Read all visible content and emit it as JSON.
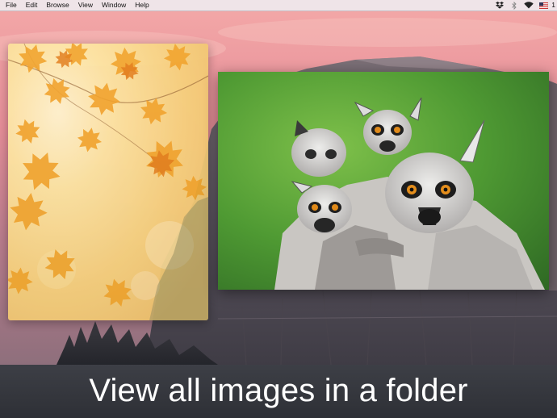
{
  "menubar": {
    "items": [
      "File",
      "Edit",
      "Browse",
      "View",
      "Window",
      "Help"
    ],
    "status_icons": [
      "dropbox-icon",
      "bluetooth-icon",
      "wifi-icon",
      "us-flag-icon"
    ],
    "clock_partial": "1"
  },
  "images": {
    "left": {
      "subject": "autumn-leaves-icon"
    },
    "right": {
      "subject": "lemurs-photo"
    }
  },
  "caption": {
    "text": "View all images in a folder"
  },
  "colors": {
    "caption_bar": "#33353c",
    "caption_text": "#ffffff",
    "menubar": "#eee8ec"
  }
}
